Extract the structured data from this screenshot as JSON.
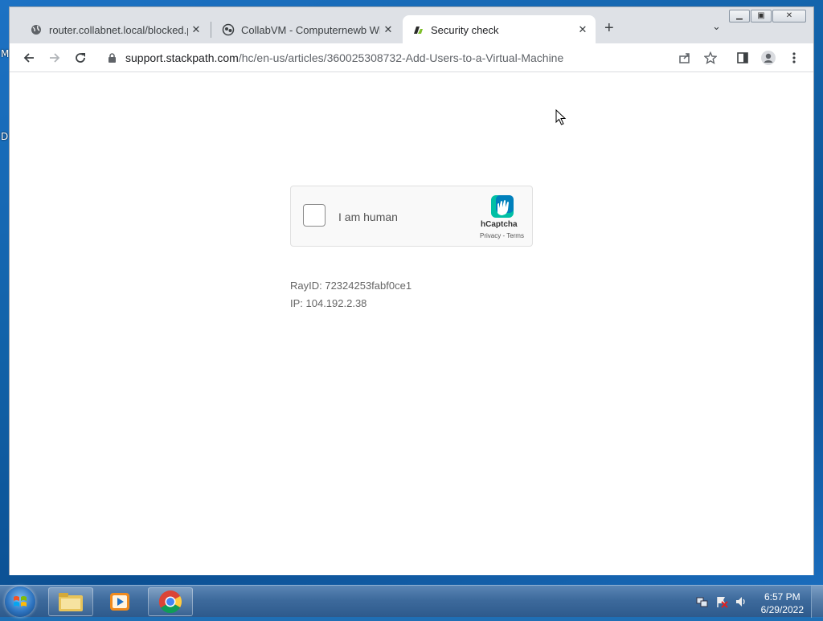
{
  "browser": {
    "tabs": [
      {
        "title": "router.collabnet.local/blocked.ph",
        "close": "✕"
      },
      {
        "title": "CollabVM - Computernewb Wiki",
        "close": "✕"
      },
      {
        "title": "Security check",
        "close": "✕",
        "active": true
      }
    ],
    "new_tab": "+",
    "tab_list": "⌄",
    "url_host": "support.stackpath.com",
    "url_path": "/hc/en-us/articles/360025308732-Add-Users-to-a-Virtual-Machine"
  },
  "page": {
    "captcha": {
      "checkbox_label": "I am human",
      "brand": "hCaptcha",
      "links": "Privacy - Terms"
    },
    "ray_id": "RayID: 72324253fabf0ce1",
    "ip": "IP: 104.192.2.38"
  },
  "desktop": {
    "stub_top": "M",
    "stub_mid": "D"
  },
  "taskbar": {
    "time": "6:57 PM",
    "date": "6/29/2022"
  },
  "colors": {
    "hcaptcha_teal": "#0074BF",
    "hcaptcha_green": "#00BFA5"
  }
}
